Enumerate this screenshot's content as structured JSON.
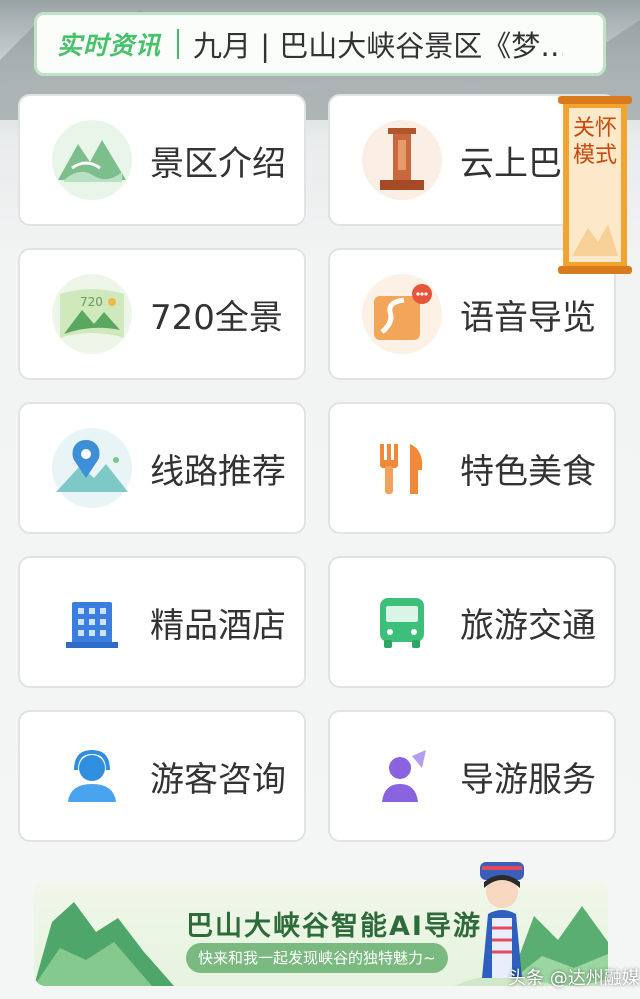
{
  "news": {
    "badge": "实时资讯",
    "headline": "九月 | 巴山大峡谷景区《梦…"
  },
  "care_mode": {
    "label": "关怀模式"
  },
  "grid": [
    {
      "label": "景区介绍",
      "icon": "scenic-mountain-icon"
    },
    {
      "label": "云上巴",
      "icon": "monument-icon"
    },
    {
      "label": "720全景",
      "icon": "panorama-720-icon"
    },
    {
      "label": "语音导览",
      "icon": "voice-guide-map-icon"
    },
    {
      "label": "线路推荐",
      "icon": "route-pin-icon"
    },
    {
      "label": "特色美食",
      "icon": "fork-knife-icon"
    },
    {
      "label": "精品酒店",
      "icon": "hotel-building-icon"
    },
    {
      "label": "旅游交通",
      "icon": "bus-icon"
    },
    {
      "label": "游客咨询",
      "icon": "customer-service-icon"
    },
    {
      "label": "导游服务",
      "icon": "tour-guide-icon"
    }
  ],
  "banner": {
    "title": "巴山大峡谷智能AI导游",
    "subtitle": "快来和我一起发现峡谷的独特魅力~"
  },
  "watermark": "头条 @达州融媒",
  "colors": {
    "accent_green": "#47c16a",
    "care_orange": "#f0a02a",
    "text": "#333333"
  }
}
